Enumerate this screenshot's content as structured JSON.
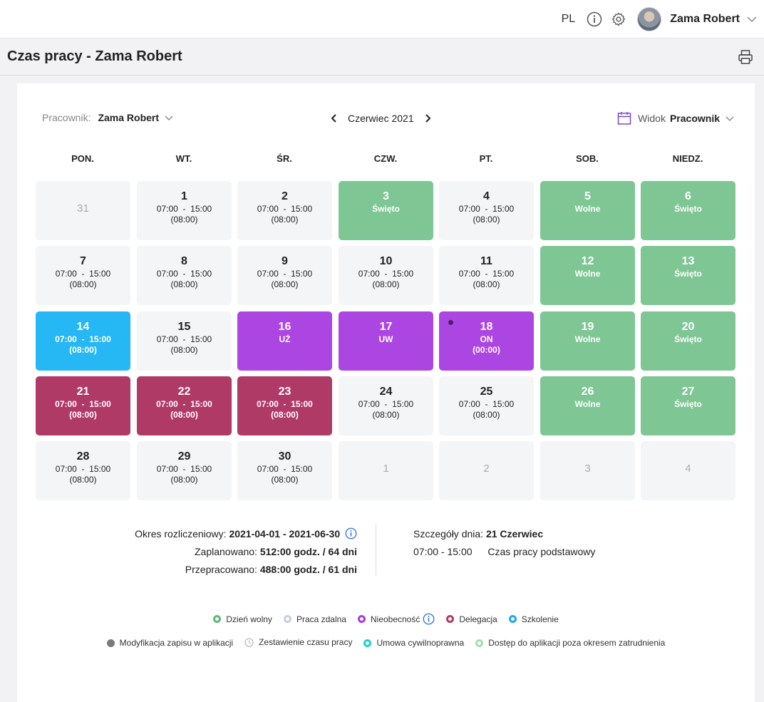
{
  "header": {
    "language": "PL",
    "user_name": "Zama Robert"
  },
  "page": {
    "title": "Czas pracy - Zama Robert"
  },
  "toolbar": {
    "employee_label": "Pracownik:",
    "employee_value": "Zama Robert",
    "month": "Czerwiec 2021",
    "view_label": "Widok",
    "view_value": "Pracownik"
  },
  "weekdays": [
    "PON.",
    "WT.",
    "ŚR.",
    "CZW.",
    "PT.",
    "SOB.",
    "NIEDZ."
  ],
  "days": [
    {
      "day": "31",
      "status": "out",
      "lines": []
    },
    {
      "day": "1",
      "status": "normal",
      "lines": [
        "07:00  -  15:00",
        "(08:00)"
      ]
    },
    {
      "day": "2",
      "status": "normal",
      "lines": [
        "07:00  -  15:00",
        "(08:00)"
      ]
    },
    {
      "day": "3",
      "status": "green",
      "lines": [
        "Święto"
      ]
    },
    {
      "day": "4",
      "status": "normal",
      "lines": [
        "07:00  -  15:00",
        "(08:00)"
      ]
    },
    {
      "day": "5",
      "status": "green",
      "lines": [
        "Wolne"
      ]
    },
    {
      "day": "6",
      "status": "green",
      "lines": [
        "Święto"
      ]
    },
    {
      "day": "7",
      "status": "normal",
      "lines": [
        "07:00  -  15:00",
        "(08:00)"
      ]
    },
    {
      "day": "8",
      "status": "normal",
      "lines": [
        "07:00  -  15:00",
        "(08:00)"
      ]
    },
    {
      "day": "9",
      "status": "normal",
      "lines": [
        "07:00  -  15:00",
        "(08:00)"
      ]
    },
    {
      "day": "10",
      "status": "normal",
      "lines": [
        "07:00  -  15:00",
        "(08:00)"
      ]
    },
    {
      "day": "11",
      "status": "normal",
      "lines": [
        "07:00  -  15:00",
        "(08:00)"
      ]
    },
    {
      "day": "12",
      "status": "green",
      "lines": [
        "Wolne"
      ]
    },
    {
      "day": "13",
      "status": "green",
      "lines": [
        "Święto"
      ]
    },
    {
      "day": "14",
      "status": "blue",
      "lines": [
        "07:00  -  15:00",
        "(08:00)"
      ]
    },
    {
      "day": "15",
      "status": "normal",
      "lines": [
        "07:00  -  15:00",
        "(08:00)"
      ]
    },
    {
      "day": "16",
      "status": "purple",
      "lines": [
        "UŻ"
      ]
    },
    {
      "day": "17",
      "status": "purple",
      "lines": [
        "UW"
      ]
    },
    {
      "day": "18",
      "status": "purple",
      "lines": [
        "ON",
        "(00:00)"
      ],
      "marker": true
    },
    {
      "day": "19",
      "status": "green",
      "lines": [
        "Wolne"
      ]
    },
    {
      "day": "20",
      "status": "green",
      "lines": [
        "Święto"
      ]
    },
    {
      "day": "21",
      "status": "crimson",
      "lines": [
        "07:00  -  15:00",
        "(08:00)"
      ]
    },
    {
      "day": "22",
      "status": "crimson",
      "lines": [
        "07:00  -  15:00",
        "(08:00)"
      ]
    },
    {
      "day": "23",
      "status": "crimson",
      "lines": [
        "07:00  -  15:00",
        "(08:00)"
      ]
    },
    {
      "day": "24",
      "status": "normal",
      "lines": [
        "07:00  -  15:00",
        "(08:00)"
      ]
    },
    {
      "day": "25",
      "status": "normal",
      "lines": [
        "07:00  -  15:00",
        "(08:00)"
      ]
    },
    {
      "day": "26",
      "status": "green",
      "lines": [
        "Wolne"
      ]
    },
    {
      "day": "27",
      "status": "green",
      "lines": [
        "Święto"
      ]
    },
    {
      "day": "28",
      "status": "normal",
      "lines": [
        "07:00  -  15:00",
        "(08:00)"
      ]
    },
    {
      "day": "29",
      "status": "normal",
      "lines": [
        "07:00  -  15:00",
        "(08:00)"
      ]
    },
    {
      "day": "30",
      "status": "normal",
      "lines": [
        "07:00  -  15:00",
        "(08:00)"
      ]
    },
    {
      "day": "1",
      "status": "out",
      "lines": []
    },
    {
      "day": "2",
      "status": "out",
      "lines": []
    },
    {
      "day": "3",
      "status": "out",
      "lines": []
    },
    {
      "day": "4",
      "status": "out",
      "lines": []
    }
  ],
  "summary": {
    "period_label": "Okres rozliczeniowy:",
    "period_value": "2021-04-01 - 2021-06-30",
    "planned_label": "Zaplanowano:",
    "planned_value": "512:00 godz. / 64 dni",
    "worked_label": "Przepracowano:",
    "worked_value": "488:00 godz. / 61 dni",
    "details_label": "Szczegóły dnia:",
    "details_value": "21 Czerwiec",
    "details_time": "07:00 - 15:00",
    "details_desc": "Czas pracy podstawowy"
  },
  "legend_row1": [
    {
      "label": "Dzień wolny",
      "color": "#5cb874",
      "style": "ring"
    },
    {
      "label": "Praca zdalna",
      "color": "#c9cde0",
      "style": "ring"
    },
    {
      "label": "Nieobecność",
      "color": "#a63ae0",
      "style": "ring",
      "info": true
    },
    {
      "label": "Delegacja",
      "color": "#b03a66",
      "style": "ring"
    },
    {
      "label": "Szkolenie",
      "color": "#1aa8f0",
      "style": "ring"
    }
  ],
  "legend_row2": [
    {
      "label": "Modyfikacja zapisu w aplikacji",
      "color": "#7a7a7a",
      "style": "solid"
    },
    {
      "label": "Zestawienie czasu pracy",
      "color": "#b5b5b5",
      "style": "clock"
    },
    {
      "label": "Umowa cywilnoprawna",
      "color": "#19d0d8",
      "style": "ring"
    },
    {
      "label": "Dostęp do aplikacji poza okresem zatrudnienia",
      "color": "#a6dcb4",
      "style": "ring"
    }
  ]
}
